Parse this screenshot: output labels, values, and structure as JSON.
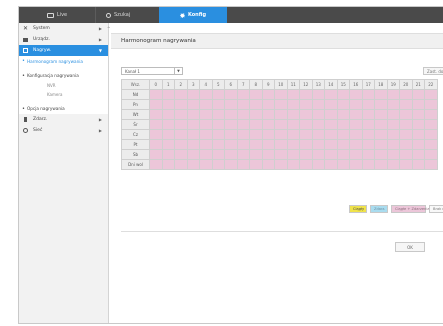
{
  "nav": {
    "tabs": [
      {
        "label": "Live",
        "icon": "monitor-icon"
      },
      {
        "label": "Szukaj",
        "icon": "search-icon"
      },
      {
        "label": "Konfig",
        "icon": "gear-icon",
        "active": true
      }
    ]
  },
  "sidebar": {
    "items": [
      {
        "label": "System",
        "icon": "tools-icon"
      },
      {
        "label": "Urządz.",
        "icon": "camera-icon"
      },
      {
        "label": "Nagryw.",
        "icon": "record-icon",
        "active": true
      }
    ],
    "active_sub": "Harmonogram nagrywania",
    "group1": "Konfiguracja nagrywania",
    "group1_leaves": [
      "NVR",
      "Kamera"
    ],
    "group2": "Opcja nagrywania",
    "items2": [
      {
        "label": "Zdarz.",
        "icon": "event-icon"
      },
      {
        "label": "Sieć",
        "icon": "network-icon"
      }
    ]
  },
  "main": {
    "title": "Harmonogram nagrywania",
    "channel_select": "Kanał 1",
    "copy_button": "Zast. do",
    "grid": {
      "header_corner": "Wsz.",
      "hours": [
        "0",
        "1",
        "2",
        "3",
        "4",
        "5",
        "6",
        "7",
        "8",
        "9",
        "10",
        "11",
        "12",
        "13",
        "14",
        "15",
        "16",
        "17",
        "18",
        "19",
        "20",
        "21",
        "22"
      ],
      "days": [
        "Nd",
        "Pn",
        "Wt",
        "Śr",
        "Cz",
        "Pt",
        "Sb",
        "Dni wol"
      ]
    },
    "legend": [
      "Ciągły",
      "Zdarz.",
      "Ciągłe + Zdarzenia",
      "Brak nagrywania"
    ],
    "ok_button": "OK"
  },
  "colors": {
    "accent": "#2a8fe0",
    "nav_bg": "#4a4a4a",
    "cell_color": "#ecc6d9",
    "continuous": "#f0e34a",
    "event": "#a9dcef"
  }
}
